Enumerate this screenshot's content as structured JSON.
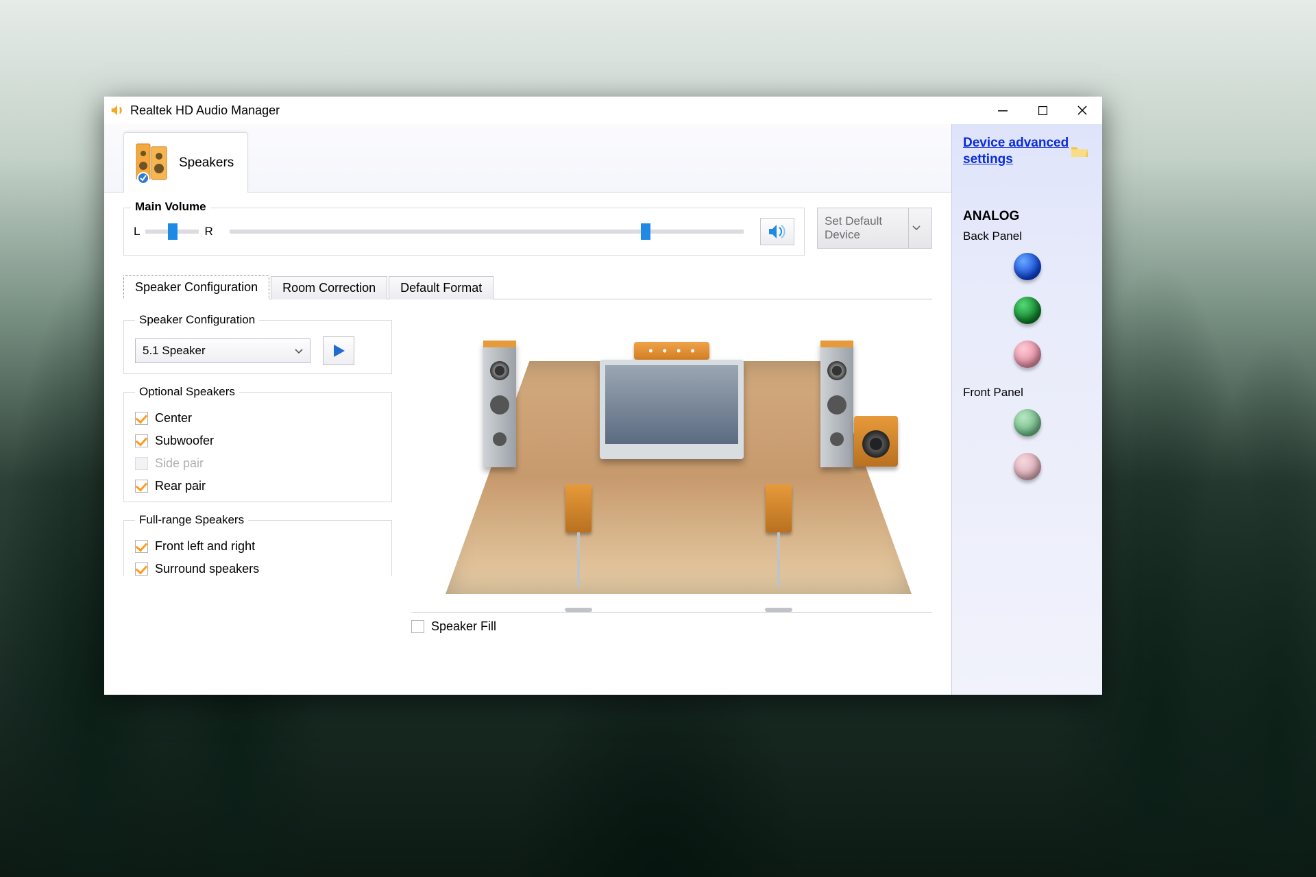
{
  "window": {
    "title": "Realtek HD Audio Manager"
  },
  "deviceTab": {
    "label": "Speakers"
  },
  "volume": {
    "legend": "Main Volume",
    "left": "L",
    "right": "R",
    "balance_percent": 48,
    "level_percent": 80,
    "default_button": "Set Default Device"
  },
  "subtabs": {
    "items": [
      {
        "label": "Speaker Configuration",
        "active": true
      },
      {
        "label": "Room Correction",
        "active": false
      },
      {
        "label": "Default Format",
        "active": false
      }
    ]
  },
  "config": {
    "legend": "Speaker Configuration",
    "selected": "5.1 Speaker"
  },
  "optional": {
    "legend": "Optional Speakers",
    "items": [
      {
        "label": "Center",
        "checked": true,
        "disabled": false
      },
      {
        "label": "Subwoofer",
        "checked": true,
        "disabled": false
      },
      {
        "label": "Side pair",
        "checked": false,
        "disabled": true
      },
      {
        "label": "Rear pair",
        "checked": true,
        "disabled": false
      }
    ]
  },
  "fullrange": {
    "legend": "Full-range Speakers",
    "items": [
      {
        "label": "Front left and right",
        "checked": true
      },
      {
        "label": "Surround speakers",
        "checked": true
      }
    ]
  },
  "speakerFill": {
    "label": "Speaker Fill",
    "checked": false
  },
  "rightPanel": {
    "advanced": "Device advanced settings",
    "analog": "ANALOG",
    "back": "Back Panel",
    "front": "Front Panel"
  }
}
